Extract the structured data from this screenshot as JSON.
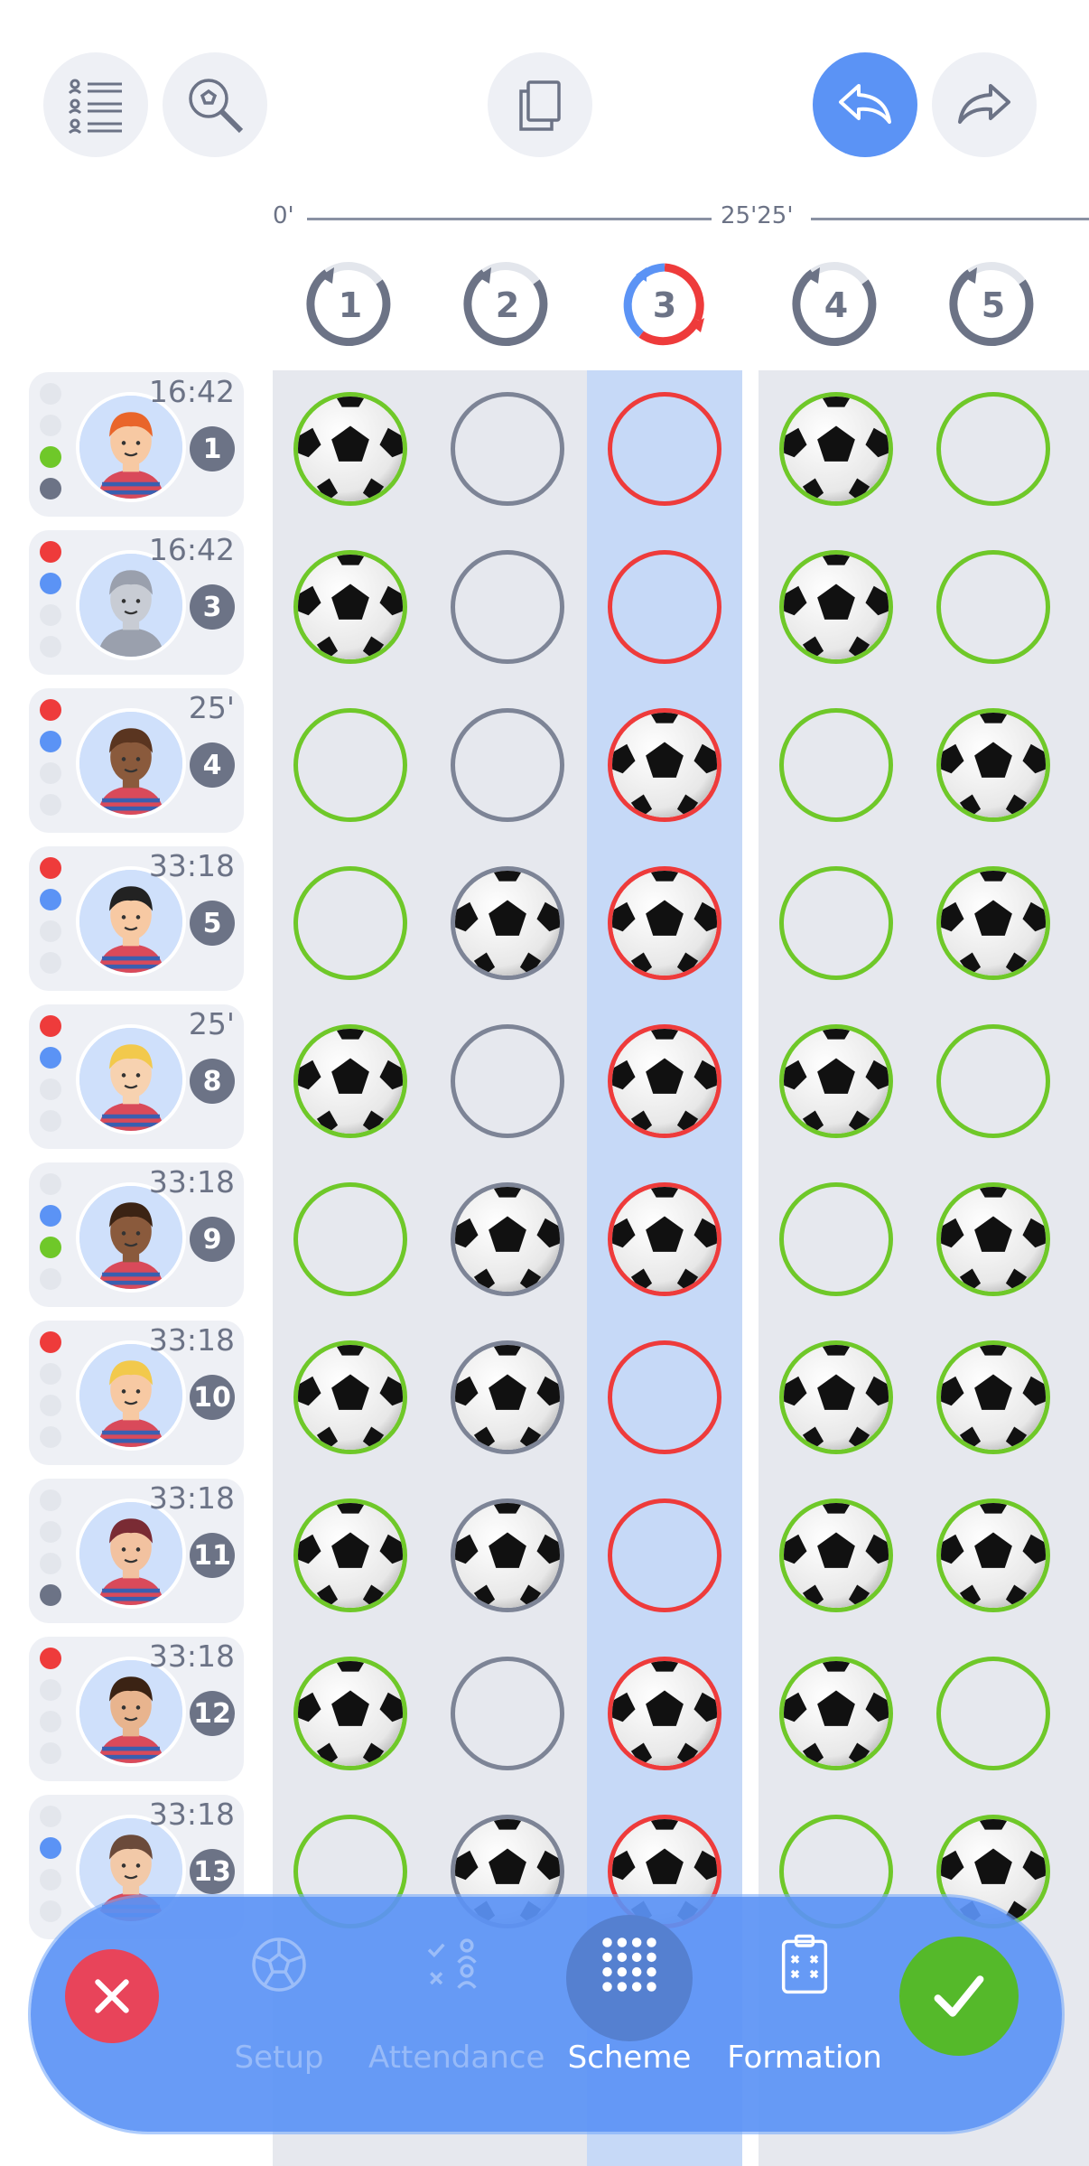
{
  "toolbar": {
    "list_icon": "player-list-icon",
    "search_icon": "ball-search-icon",
    "copy_icon": "copy-icon",
    "undo_icon": "undo-icon",
    "redo_icon": "redo-icon"
  },
  "timeline": {
    "start": "0'",
    "mid": "25'25'"
  },
  "periods": [
    "1",
    "2",
    "3",
    "4",
    "5"
  ],
  "active_period": 3,
  "colors": {
    "accent": "#5b93f5",
    "green": "#6fc829",
    "red": "#ee3b3b",
    "gray": "#7d8496",
    "active_col": "#c6d9f7"
  },
  "players": [
    {
      "time": "16:42",
      "number": "1",
      "dots": [
        "none",
        "none",
        "green",
        "gray"
      ],
      "cells": [
        "G",
        "N",
        "R",
        "G",
        "G"
      ],
      "balls": [
        1,
        0,
        0,
        1,
        0
      ]
    },
    {
      "time": "16:42",
      "number": "3",
      "dots": [
        "red",
        "blue",
        "none",
        "none"
      ],
      "cells": [
        "G",
        "N",
        "R",
        "G",
        "G"
      ],
      "balls": [
        1,
        0,
        0,
        1,
        0
      ]
    },
    {
      "time": "25'",
      "number": "4",
      "dots": [
        "red",
        "blue",
        "none",
        "none"
      ],
      "cells": [
        "G",
        "N",
        "R",
        "G",
        "G"
      ],
      "balls": [
        0,
        0,
        1,
        0,
        1
      ]
    },
    {
      "time": "33:18",
      "number": "5",
      "dots": [
        "red",
        "blue",
        "none",
        "none"
      ],
      "cells": [
        "G",
        "N",
        "R",
        "G",
        "G"
      ],
      "balls": [
        0,
        1,
        1,
        0,
        1
      ]
    },
    {
      "time": "25'",
      "number": "8",
      "dots": [
        "red",
        "blue",
        "none",
        "none"
      ],
      "cells": [
        "G",
        "N",
        "R",
        "G",
        "G"
      ],
      "balls": [
        1,
        0,
        1,
        1,
        0
      ]
    },
    {
      "time": "33:18",
      "number": "9",
      "dots": [
        "none",
        "blue",
        "green",
        "none"
      ],
      "cells": [
        "G",
        "N",
        "R",
        "G",
        "G"
      ],
      "balls": [
        0,
        1,
        1,
        0,
        1
      ]
    },
    {
      "time": "33:18",
      "number": "10",
      "dots": [
        "red",
        "none",
        "none",
        "none"
      ],
      "cells": [
        "G",
        "N",
        "R",
        "G",
        "G"
      ],
      "balls": [
        1,
        1,
        0,
        1,
        1
      ]
    },
    {
      "time": "33:18",
      "number": "11",
      "dots": [
        "none",
        "none",
        "none",
        "gray"
      ],
      "cells": [
        "G",
        "N",
        "R",
        "G",
        "G"
      ],
      "balls": [
        1,
        1,
        0,
        1,
        1
      ]
    },
    {
      "time": "33:18",
      "number": "12",
      "dots": [
        "red",
        "none",
        "none",
        "none"
      ],
      "cells": [
        "G",
        "N",
        "R",
        "G",
        "G"
      ],
      "balls": [
        1,
        0,
        1,
        1,
        0
      ]
    },
    {
      "time": "33:18",
      "number": "13",
      "dots": [
        "none",
        "blue",
        "none",
        "none"
      ],
      "cells": [
        "G",
        "N",
        "R",
        "G",
        "G"
      ],
      "balls": [
        0,
        1,
        1,
        0,
        1
      ]
    }
  ],
  "bottom_nav": {
    "cancel_icon": "close-icon",
    "confirm_icon": "check-icon",
    "items": [
      {
        "label": "Setup",
        "icon": "ball-icon",
        "state": "dim"
      },
      {
        "label": "Attendance",
        "icon": "attendance-icon",
        "state": "dim"
      },
      {
        "label": "Scheme",
        "icon": "grid-dots-icon",
        "state": "active"
      },
      {
        "label": "Formation",
        "icon": "clipboard-icon",
        "state": "white"
      }
    ]
  }
}
